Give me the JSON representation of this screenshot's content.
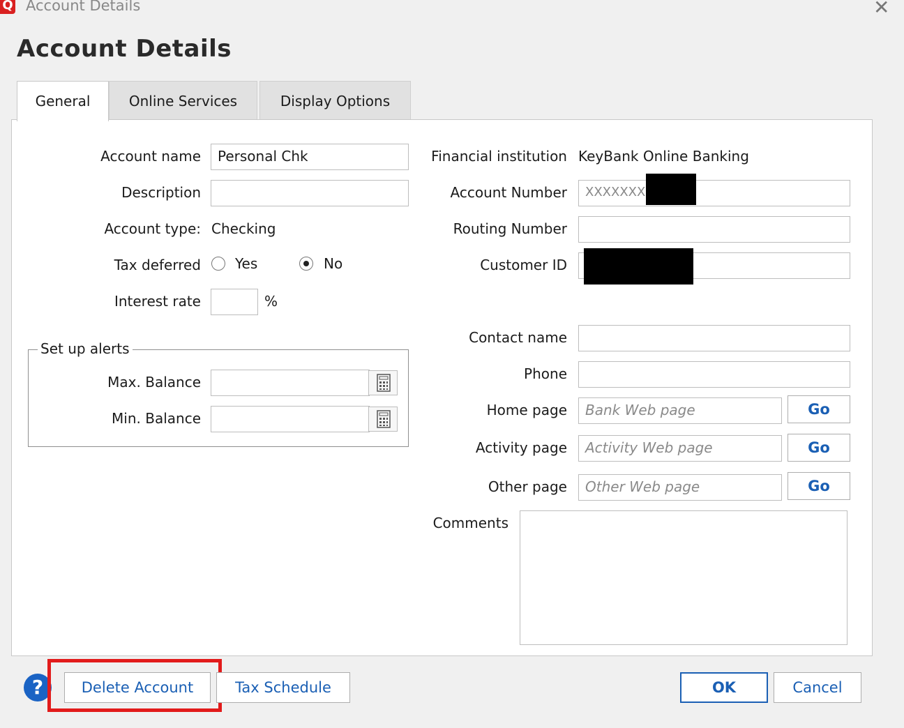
{
  "window": {
    "title": "Account Details",
    "app_icon": "Q"
  },
  "heading": "Account Details",
  "tabs": [
    {
      "label": "General",
      "active": true
    },
    {
      "label": "Online Services",
      "active": false
    },
    {
      "label": "Display Options",
      "active": false
    }
  ],
  "left": {
    "account_name": {
      "label": "Account name",
      "value": "Personal Chk"
    },
    "description": {
      "label": "Description",
      "value": ""
    },
    "account_type": {
      "label": "Account type:",
      "value": "Checking"
    },
    "tax_deferred": {
      "label": "Tax deferred",
      "yes": "Yes",
      "no": "No",
      "selected": "No"
    },
    "interest_rate": {
      "label": "Interest rate",
      "value": "",
      "unit": "%"
    },
    "alerts": {
      "title": "Set up alerts",
      "max_balance": {
        "label": "Max. Balance",
        "value": ""
      },
      "min_balance": {
        "label": "Min. Balance",
        "value": ""
      }
    }
  },
  "right": {
    "financial_institution": {
      "label": "Financial institution",
      "value": "KeyBank Online Banking"
    },
    "account_number": {
      "label": "Account Number",
      "value": "XXXXXXX"
    },
    "routing_number": {
      "label": "Routing Number",
      "value": ""
    },
    "customer_id": {
      "label": "Customer ID",
      "value": ""
    },
    "contact_name": {
      "label": "Contact name",
      "value": ""
    },
    "phone": {
      "label": "Phone",
      "value": ""
    },
    "home_page": {
      "label": "Home page",
      "placeholder": "Bank Web page",
      "go": "Go"
    },
    "activity_page": {
      "label": "Activity page",
      "placeholder": "Activity Web page",
      "go": "Go"
    },
    "other_page": {
      "label": "Other page",
      "placeholder": "Other Web page",
      "go": "Go"
    },
    "comments": {
      "label": "Comments",
      "value": ""
    }
  },
  "footer": {
    "help": "?",
    "delete_account": "Delete Account",
    "tax_schedule": "Tax Schedule",
    "ok": "OK",
    "cancel": "Cancel"
  },
  "colors": {
    "accent": "#1a5fb4",
    "highlight": "#e21b1b",
    "app_icon": "#d92020"
  }
}
